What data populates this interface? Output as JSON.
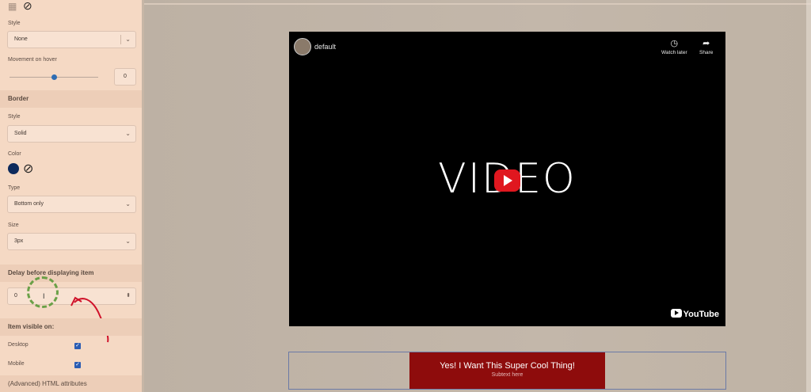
{
  "sidebar": {
    "style_label": "Style",
    "style_value": "None",
    "movement_label": "Movement on hover",
    "movement_value": "0",
    "movement_fraction": 0.5,
    "border_header": "Border",
    "border_style_label": "Style",
    "border_style_value": "Solid",
    "color_label": "Color",
    "color_value": "#0d2a5c",
    "type_label": "Type",
    "type_value": "Bottom only",
    "size_label": "Size",
    "size_value": "3px",
    "delay_header": "Delay before displaying item",
    "delay_value": "0",
    "visible_header": "Item visible on:",
    "desktop_label": "Desktop",
    "desktop_checked": true,
    "mobile_label": "Mobile",
    "mobile_checked": true,
    "advanced_header": "(Advanced) HTML attributes"
  },
  "video": {
    "channel": "default",
    "watch_later": "Watch later",
    "share": "Share",
    "title": "VIDEO",
    "logo_text": "YouTube"
  },
  "cta": {
    "main": "Yes! I Want This Super Cool Thing!",
    "sub": "Subtext here",
    "color": "#8e0c0c"
  }
}
